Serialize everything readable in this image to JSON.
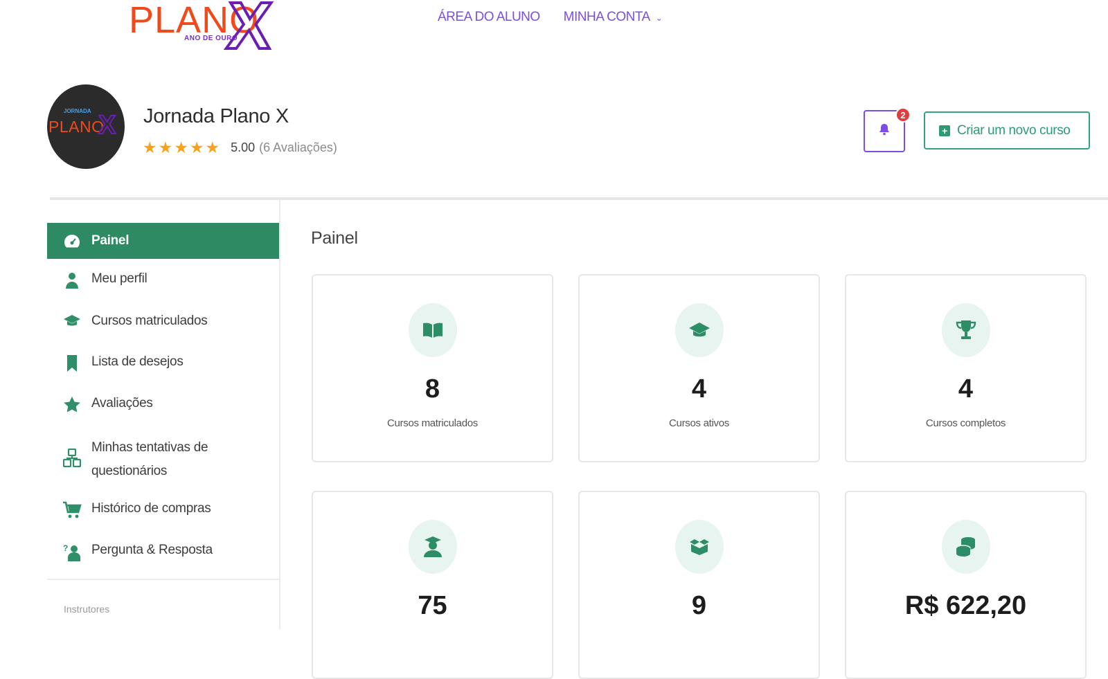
{
  "header": {
    "logo_text": "PLANO",
    "logo_x": "X",
    "logo_subtitle": "ANO DE OURO",
    "nav": [
      {
        "label": "ÁREA DO ALUNO"
      },
      {
        "label": "MINHA CONTA"
      }
    ]
  },
  "profile": {
    "avatar_small": "JORNADA",
    "avatar_plano": "PLANO",
    "avatar_x": "X",
    "name": "Jornada Plano X",
    "stars": "★★★★★",
    "rating_value": 5.0,
    "score": "5.00",
    "reviews": "(6 Avaliações)"
  },
  "actions": {
    "notifications_count": "2",
    "create_course": "Criar um novo curso"
  },
  "sidebar": {
    "items": [
      {
        "label": "Painel",
        "icon": "dashboard-icon"
      },
      {
        "label": "Meu perfil",
        "icon": "user-icon"
      },
      {
        "label": "Cursos matriculados",
        "icon": "graduation-cap-icon"
      },
      {
        "label": "Lista de desejos",
        "icon": "bookmark-icon"
      },
      {
        "label": "Avaliações",
        "icon": "star-icon"
      },
      {
        "label": "Minhas tentativas de questionários",
        "icon": "quiz-icon"
      },
      {
        "label": "Histórico de compras",
        "icon": "cart-icon"
      },
      {
        "label": "Pergunta & Resposta",
        "icon": "question-answer-icon"
      }
    ],
    "section_label": "Instrutores"
  },
  "main": {
    "title": "Painel",
    "cards": [
      {
        "value": "8",
        "label": "Cursos matriculados",
        "icon": "book-open-icon"
      },
      {
        "value": "4",
        "label": "Cursos ativos",
        "icon": "graduation-cap-icon"
      },
      {
        "value": "4",
        "label": "Cursos completos",
        "icon": "trophy-icon"
      },
      {
        "value": "75",
        "label": "",
        "icon": "student-icon"
      },
      {
        "value": "9",
        "label": "",
        "icon": "courses-box-icon"
      },
      {
        "value": "R$ 622,20",
        "label": "",
        "icon": "coins-icon"
      }
    ]
  },
  "colors": {
    "accent_green": "#2e8a63",
    "accent_purple": "#7b4ee3",
    "logo_orange": "#f04a1c",
    "star_orange": "#f7a21a",
    "badge_red": "#e23b3b"
  }
}
